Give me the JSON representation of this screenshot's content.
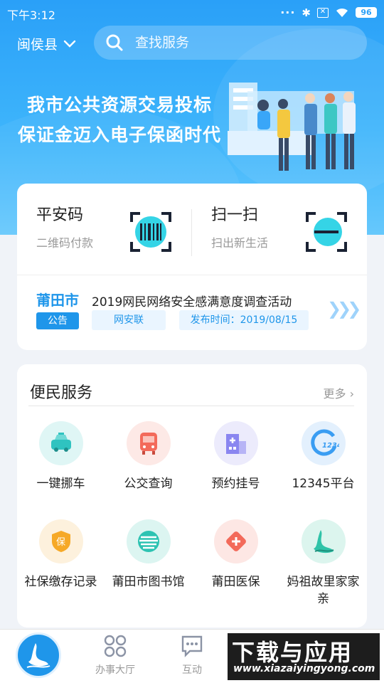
{
  "status_bar": {
    "time": "下午3:12",
    "battery": "96"
  },
  "header": {
    "city": "闽侯县",
    "search_placeholder": "查找服务"
  },
  "banner": {
    "line1": "我市公共资源交易投标",
    "line2": "保证金迈入电子保函时代"
  },
  "quick_actions": [
    {
      "title": "平安码",
      "subtitle": "二维码付款"
    },
    {
      "title": "扫一扫",
      "subtitle": "扫出新生活"
    }
  ],
  "notice": {
    "logo_text": "莆田市",
    "tag": "公告",
    "title": "2019网民网络安全感满意度调查活动",
    "source": "网安联",
    "date": "发布时间：2019/08/15"
  },
  "services": {
    "heading": "便民服务",
    "more": "更多",
    "items": [
      {
        "label": "一键挪车",
        "icon": "car-icon",
        "color": "#2fc3c0"
      },
      {
        "label": "公交查询",
        "icon": "bus-icon",
        "color": "#f36a5a"
      },
      {
        "label": "预约挂号",
        "icon": "hospital-icon",
        "color": "#8a86f0"
      },
      {
        "label": "12345平台",
        "icon": "hotline-12345-icon",
        "color": "#3a9df2"
      },
      {
        "label": "社保缴存记录",
        "icon": "shield-icon",
        "color": "#f6a927"
      },
      {
        "label": "莆田市图书馆",
        "icon": "library-icon",
        "color": "#2ec3b2"
      },
      {
        "label": "莆田医保",
        "icon": "medical-icon",
        "color": "#f36a5a"
      },
      {
        "label": "妈祖故里家家亲",
        "icon": "mazu-icon",
        "color": "#2fc3a8"
      }
    ]
  },
  "tabbar": {
    "tab1": "办事大厅",
    "tab2": "互动"
  },
  "watermark": {
    "big": "下载与应用",
    "small": "www.xiazaiyingyong.com"
  }
}
